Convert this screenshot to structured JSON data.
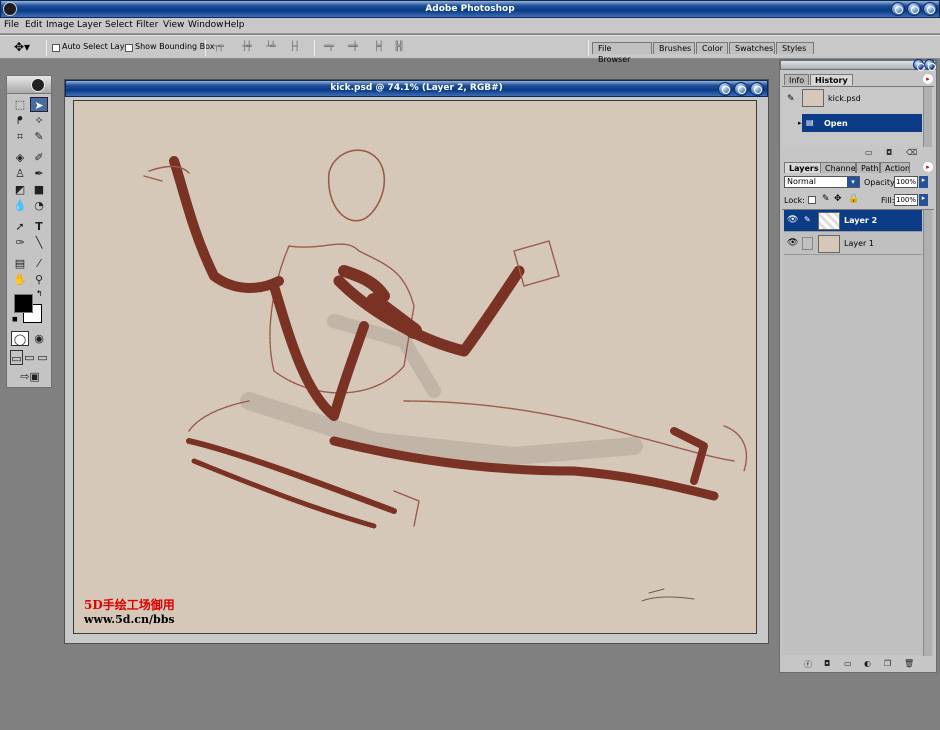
{
  "app": {
    "title": "Adobe Photoshop"
  },
  "menu": [
    "File",
    "Edit",
    "Image",
    "Layer",
    "Select",
    "Filter",
    "View",
    "Window",
    "Help"
  ],
  "options": {
    "auto_select_label": "Auto Select Layer",
    "bounding_box_label": "Show Bounding Box",
    "palette_tabs": [
      "File Browser",
      "Brushes",
      "Color",
      "Swatches",
      "Styles"
    ]
  },
  "document": {
    "title": "kick.psd @ 74.1% (Layer 2, RGB#)",
    "watermark_line1": "5D手绘工场御用",
    "watermark_line2": "www.5d.cn/bbs"
  },
  "history": {
    "tabs": [
      "Info",
      "History"
    ],
    "snapshot_label": "kick.psd",
    "items": [
      "Open"
    ]
  },
  "layers": {
    "tabs": [
      "Layers",
      "Channels",
      "Paths",
      "Actions"
    ],
    "blend_mode": "Normal",
    "opacity_label": "Opacity:",
    "opacity_value": "100%",
    "lock_label": "Lock:",
    "fill_label": "Fill:",
    "fill_value": "100%",
    "items": [
      {
        "name": "Layer 2",
        "selected": true
      },
      {
        "name": "Layer 1",
        "selected": false
      }
    ]
  },
  "colors": {
    "accent": "#0a3a86",
    "selection": "#0c3c86",
    "canvas": "#d5c8b8",
    "stroke": "#7a3224"
  }
}
